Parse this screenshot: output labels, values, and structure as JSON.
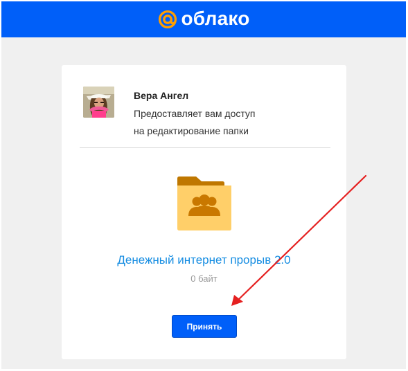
{
  "header": {
    "logo_text": "облако",
    "brand_color": "#005ff9",
    "accent_color": "#ff9e00",
    "logo_icon": "at-sign-icon"
  },
  "share": {
    "sender_name": "Вера Ангел",
    "description_line_1": "Предоставляет вам доступ",
    "description_line_2": "на редактирование папки",
    "avatar_icon": "avatar"
  },
  "folder": {
    "icon": "shared-folder-icon",
    "name": "Денежный интернет прорыв 2.0",
    "size": "0 байт"
  },
  "actions": {
    "accept_label": "Принять"
  },
  "annotation": {
    "icon": "red-arrow",
    "color": "#e52020"
  }
}
